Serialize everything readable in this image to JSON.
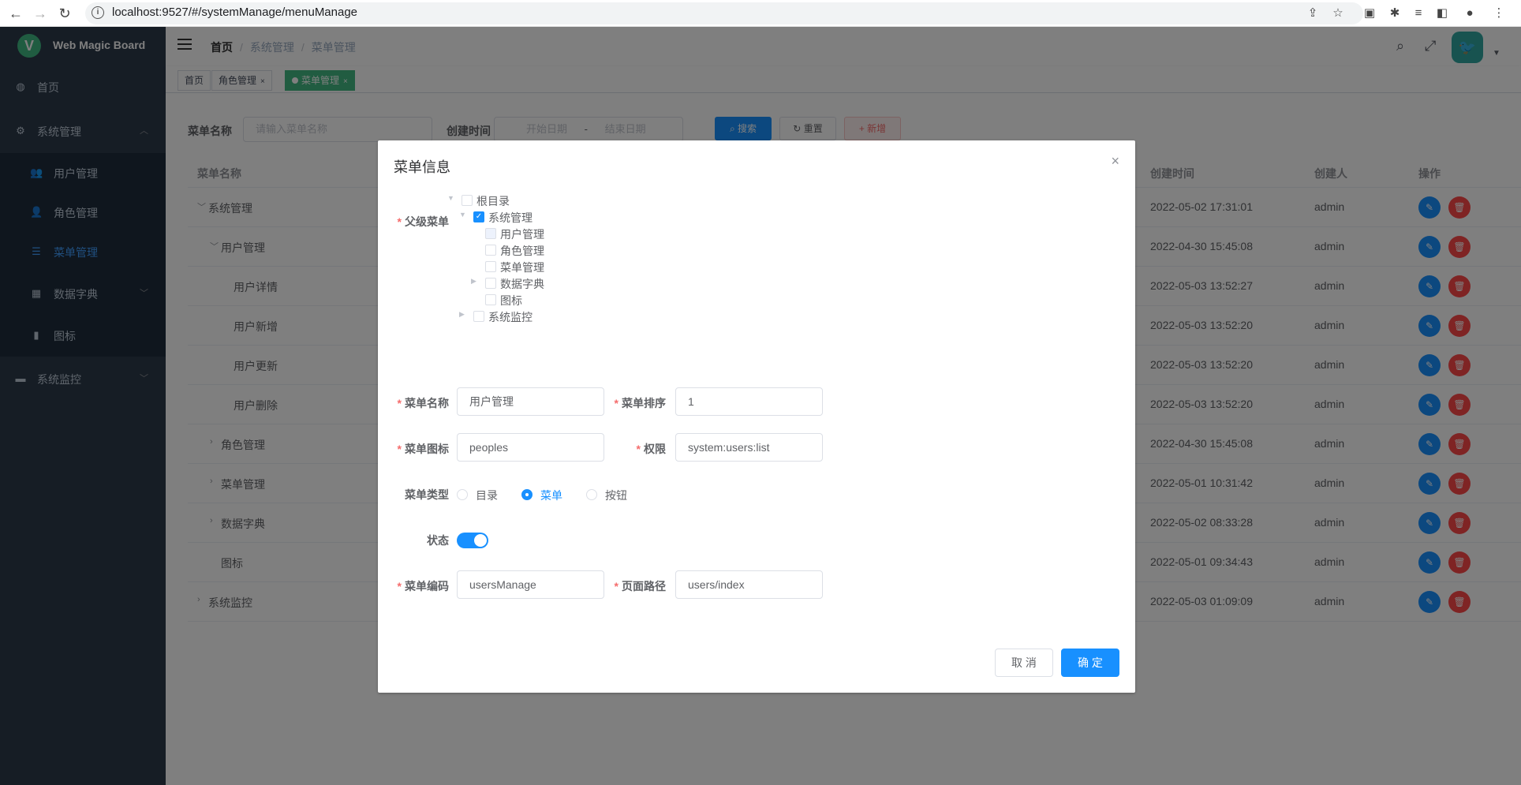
{
  "browser": {
    "url": "localhost:9527/#/systemManage/menuManage"
  },
  "app": {
    "logo_letter": "V",
    "title": "Web Magic Board"
  },
  "sidebar": {
    "items": [
      {
        "label": "首页",
        "icon": "dashboard-icon"
      },
      {
        "label": "系统管理",
        "icon": "gear-icon",
        "expanded": true
      },
      {
        "label": "用户管理",
        "icon": "users-icon"
      },
      {
        "label": "角色管理",
        "icon": "user-icon"
      },
      {
        "label": "菜单管理",
        "icon": "tree-table-icon",
        "active": true
      },
      {
        "label": "数据字典",
        "icon": "book-icon"
      },
      {
        "label": "图标",
        "icon": "icon-icon"
      },
      {
        "label": "系统监控",
        "icon": "monitor-icon"
      }
    ]
  },
  "breadcrumb": [
    "首页",
    "系统管理",
    "菜单管理"
  ],
  "tags": [
    {
      "label": "首页"
    },
    {
      "label": "角色管理"
    },
    {
      "label": "菜单管理",
      "active": true
    }
  ],
  "search": {
    "name_label": "菜单名称",
    "name_placeholder": "请输入菜单名称",
    "time_label": "创建时间",
    "start_placeholder": "开始日期",
    "range_sep": "-",
    "end_placeholder": "结束日期",
    "search_btn": "搜索",
    "reset_btn": "重置",
    "add_btn": "新增"
  },
  "table": {
    "headers": {
      "name": "菜单名称",
      "time": "创建时间",
      "creator": "创建人",
      "ops": "操作"
    },
    "rows": [
      {
        "name": "系统管理",
        "time": "2022-05-02 17:31:01",
        "creator": "admin",
        "indent": 0,
        "arrow": "v"
      },
      {
        "name": "用户管理",
        "time": "2022-04-30 15:45:08",
        "creator": "admin",
        "indent": 1,
        "arrow": "v"
      },
      {
        "name": "用户详情",
        "time": "2022-05-03 13:52:27",
        "creator": "admin",
        "indent": 2,
        "arrow": ""
      },
      {
        "name": "用户新增",
        "time": "2022-05-03 13:52:20",
        "creator": "admin",
        "indent": 2,
        "arrow": ""
      },
      {
        "name": "用户更新",
        "time": "2022-05-03 13:52:20",
        "creator": "admin",
        "indent": 2,
        "arrow": ""
      },
      {
        "name": "用户删除",
        "time": "2022-05-03 13:52:20",
        "creator": "admin",
        "indent": 2,
        "arrow": ""
      },
      {
        "name": "角色管理",
        "time": "2022-04-30 15:45:08",
        "creator": "admin",
        "indent": 1,
        "arrow": ">"
      },
      {
        "name": "菜单管理",
        "time": "2022-05-01 10:31:42",
        "creator": "admin",
        "indent": 1,
        "arrow": ">"
      },
      {
        "name": "数据字典",
        "time": "2022-05-02 08:33:28",
        "creator": "admin",
        "indent": 1,
        "arrow": ">"
      },
      {
        "name": "图标",
        "time": "2022-05-01 09:34:43",
        "creator": "admin",
        "indent": 1,
        "arrow": ""
      },
      {
        "name": "系统监控",
        "time": "2022-05-03 01:09:09",
        "creator": "admin",
        "indent": 0,
        "arrow": ">"
      }
    ]
  },
  "dialog": {
    "title": "菜单信息",
    "parent_label": "父级菜单",
    "tree": [
      {
        "label": "根目录",
        "level": 0,
        "caret": "open",
        "checked": false
      },
      {
        "label": "系统管理",
        "level": 1,
        "caret": "open",
        "checked": true
      },
      {
        "label": "用户管理",
        "level": 2,
        "caret": "",
        "checked": false,
        "highlight": true
      },
      {
        "label": "角色管理",
        "level": 2,
        "caret": "",
        "checked": false
      },
      {
        "label": "菜单管理",
        "level": 2,
        "caret": "",
        "checked": false
      },
      {
        "label": "数据字典",
        "level": 2,
        "caret": "closed",
        "checked": false
      },
      {
        "label": "图标",
        "level": 2,
        "caret": "",
        "checked": false
      },
      {
        "label": "系统监控",
        "level": 1,
        "caret": "closed",
        "checked": false
      }
    ],
    "name_label": "菜单名称",
    "name_value": "用户管理",
    "sort_label": "菜单排序",
    "sort_value": "1",
    "icon_label": "菜单图标",
    "icon_value": "peoples",
    "perm_label": "权限",
    "perm_value": "system:users:list",
    "type_label": "菜单类型",
    "type_options": [
      "目录",
      "菜单",
      "按钮"
    ],
    "type_selected": "菜单",
    "status_label": "状态",
    "status_on": true,
    "code_label": "菜单编码",
    "code_value": "usersManage",
    "path_label": "页面路径",
    "path_value": "users/index",
    "cancel_btn": "取 消",
    "ok_btn": "确 定"
  },
  "colors": {
    "sidebar_bg": "#2d3a4b",
    "primary": "#1890ff",
    "danger": "#ff4949",
    "tag_active": "#42b983"
  }
}
